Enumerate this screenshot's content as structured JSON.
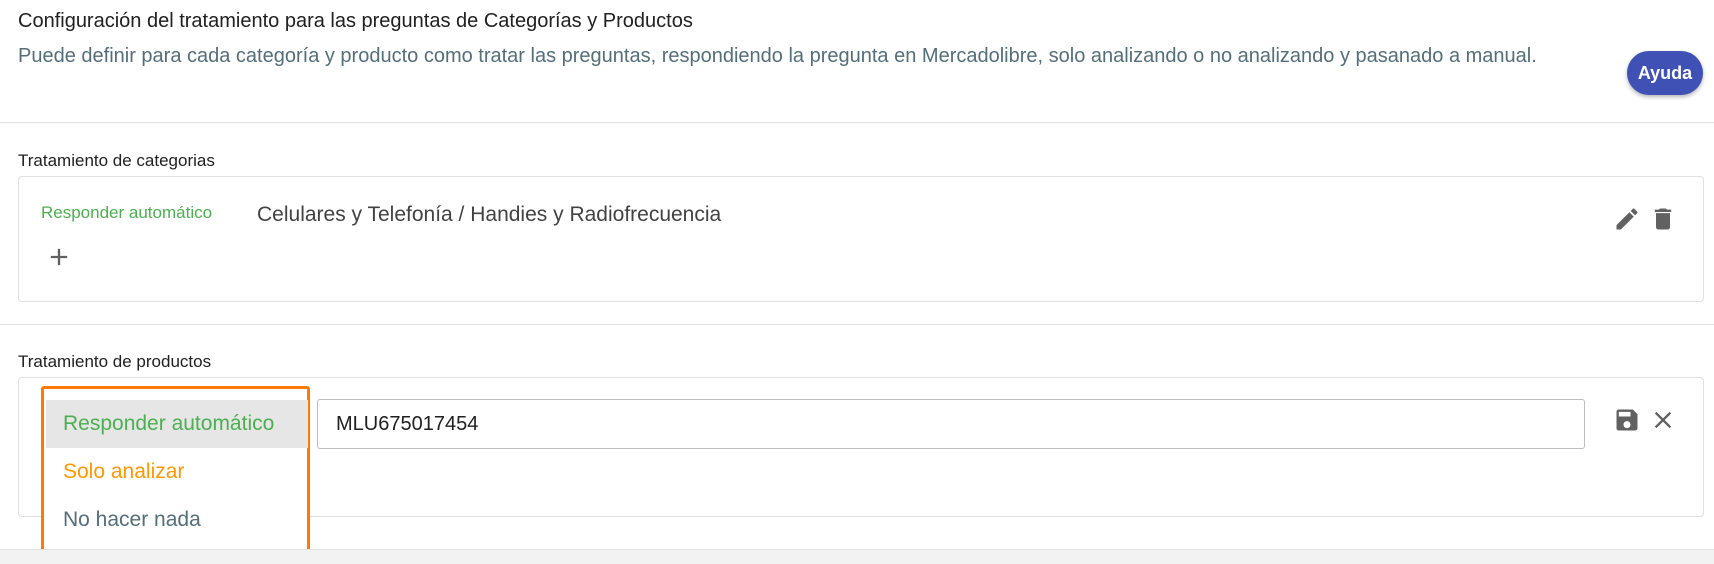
{
  "header": {
    "title": "Configuración del tratamiento para las preguntas de Categorías y Productos",
    "description": "Puede definir para cada categoría y producto como tratar las preguntas, respondiendo la pregunta en Mercadolibre, solo analizando o no analizando y pasanado a manual.",
    "help_label": "Ayuda"
  },
  "categories": {
    "title": "Tratamiento de categorias",
    "items": [
      {
        "status": "Responder automático",
        "name": "Celulares y Telefonía / Handies y Radiofrecuencia"
      }
    ]
  },
  "products": {
    "title": "Tratamiento de productos",
    "input_value": "MLU675017454",
    "options": [
      {
        "label": "Responder automático",
        "color": "#4caf50",
        "selected": true
      },
      {
        "label": "Solo analizar",
        "color": "#ff9800",
        "selected": false
      },
      {
        "label": "No hacer nada",
        "color": "#546e7a",
        "selected": false
      }
    ]
  },
  "colors": {
    "accent": "#3f51b5",
    "highlight_border": "#ff7a00",
    "auto": "#4caf50",
    "analyze": "#ff9800"
  }
}
